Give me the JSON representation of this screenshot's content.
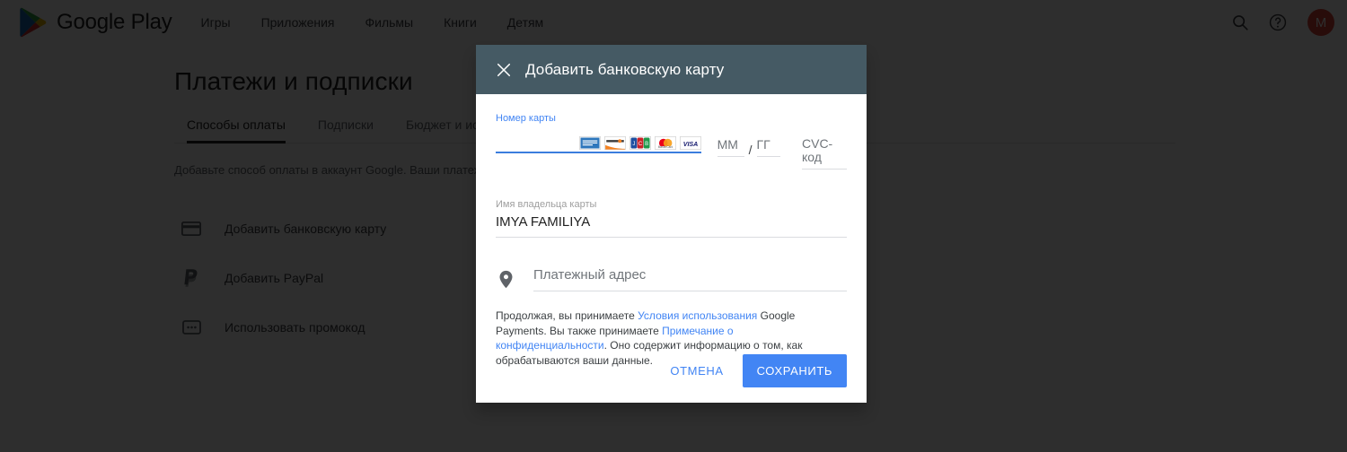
{
  "header": {
    "brand": "Google Play",
    "nav": [
      {
        "label": "Игры"
      },
      {
        "label": "Приложения"
      },
      {
        "label": "Фильмы"
      },
      {
        "label": "Книги"
      },
      {
        "label": "Детям"
      }
    ],
    "search_icon": "search-icon",
    "help_icon": "help-circle-icon",
    "avatar_initial": "M",
    "avatar_color": "#db4437"
  },
  "page": {
    "title": "Платежи и подписки",
    "tabs": [
      {
        "label": "Способы оплаты",
        "active": true
      },
      {
        "label": "Подписки",
        "active": false
      },
      {
        "label": "Бюджет и история",
        "active": false
      }
    ],
    "lead_text": "Добавьте способ оплаты в аккаунт Google. Ваши платежные данные защищены.",
    "methods": [
      {
        "icon": "credit-card-icon",
        "label": "Добавить банковскую карту"
      },
      {
        "icon": "paypal-icon",
        "label": "Добавить PayPal"
      },
      {
        "icon": "promo-code-icon",
        "label": "Использовать промокод"
      }
    ]
  },
  "modal": {
    "title": "Добавить банковскую карту",
    "close_icon": "close-icon",
    "header_color": "#455a64",
    "card_number": {
      "label": "Номер карты",
      "value": "",
      "focused": true,
      "accent_color": "#4285f4"
    },
    "card_brands": [
      {
        "name": "american-express"
      },
      {
        "name": "discover"
      },
      {
        "name": "jcb"
      },
      {
        "name": "mastercard"
      },
      {
        "name": "visa"
      }
    ],
    "expiry": {
      "month_placeholder": "ММ",
      "separator": "/",
      "year_placeholder": "ГГ",
      "month_value": "",
      "year_value": ""
    },
    "cvc": {
      "label": "CVC-код",
      "value": ""
    },
    "cardholder": {
      "label": "Имя владельца карты",
      "value": "IMYA FAMILIYA"
    },
    "address": {
      "icon": "location-pin-icon",
      "placeholder": "Платежный адрес",
      "value": ""
    },
    "terms": {
      "part1": "Продолжая, вы принимаете ",
      "link1": "Условия использования",
      "part2": " Google Payments. Вы также принимаете ",
      "link2": "Примечание о конфиденциальности",
      "part3": ". Оно содержит информацию о том, как обрабатываются ваши данные."
    },
    "cancel_label": "ОТМЕНА",
    "save_label": "СОХРАНИТЬ",
    "save_color": "#4285f4"
  }
}
